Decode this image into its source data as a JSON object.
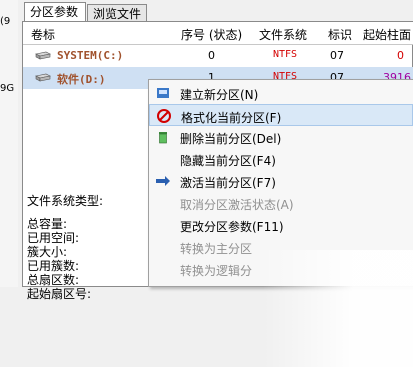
{
  "left_fragments": [
    "(9",
    "9G"
  ],
  "tabs": [
    "分区参数",
    "浏览文件"
  ],
  "columns": [
    "卷标",
    "序号 (状态)",
    "文件系统",
    "标识",
    "起始柱面"
  ],
  "rows": [
    {
      "label": "SYSTEM(C:)",
      "index": "0",
      "fs": "NTFS",
      "id": "07",
      "start": "0"
    },
    {
      "label": "软件(D:)",
      "index": "1",
      "fs": "NTFS",
      "id": "07",
      "start": "3916"
    }
  ],
  "info": {
    "fs_type": "文件系统类型:",
    "total": "总容量:",
    "used": "已用空间:",
    "cluster": "簇大小:",
    "used_clusters": "已用簇数:",
    "total_sectors": "总扇区数:",
    "start_sector": "起始扇区号:"
  },
  "menu": [
    {
      "label": "建立新分区(N)",
      "icon": "new-partition-icon",
      "disabled": false
    },
    {
      "label": "格式化当前分区(F)",
      "icon": "format-icon",
      "disabled": false,
      "highlight": true
    },
    {
      "label": "删除当前分区(Del)",
      "icon": "trash-icon",
      "disabled": false
    },
    {
      "label": "隐藏当前分区(F4)",
      "icon": "",
      "disabled": false
    },
    {
      "label": "激活当前分区(F7)",
      "icon": "activate-icon",
      "disabled": false
    },
    {
      "label": "取消分区激活状态(A)",
      "icon": "",
      "disabled": true
    },
    {
      "label": "更改分区参数(F11)",
      "icon": "",
      "disabled": false
    },
    {
      "label": "转换为主分区",
      "icon": "",
      "disabled": true
    },
    {
      "label": "转换为逻辑分",
      "icon": "",
      "disabled": true
    }
  ]
}
